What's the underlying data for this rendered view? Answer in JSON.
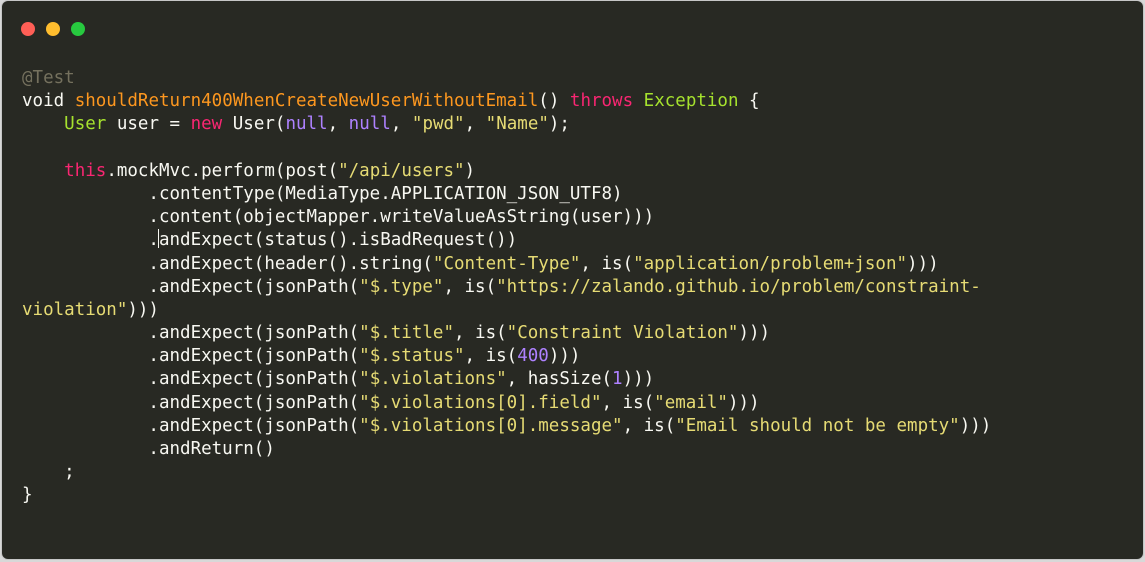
{
  "window": {
    "traffic_lights": [
      {
        "name": "close-button",
        "color": "#ff5f56"
      },
      {
        "name": "minimize-button",
        "color": "#ffbd2e"
      },
      {
        "name": "zoom-button",
        "color": "#27c93f"
      }
    ]
  },
  "colors": {
    "background": "#282923",
    "default": "#f8f8f2",
    "comment": "#75715e",
    "keyword": "#f92672",
    "function": "#fd971f",
    "type": "#a6e22e",
    "string": "#e6db74",
    "constant": "#ae81ff"
  },
  "editor": {
    "language": "java",
    "cursor": {
      "line": 7,
      "column": 13
    },
    "lines": [
      [
        {
          "t": "@Test",
          "c": "comment"
        }
      ],
      [
        {
          "t": "void",
          "c": "default"
        },
        {
          "t": " ",
          "c": "default"
        },
        {
          "t": "shouldReturn400WhenCreateNewUserWithoutEmail",
          "c": "function"
        },
        {
          "t": "() ",
          "c": "default"
        },
        {
          "t": "throws",
          "c": "keyword"
        },
        {
          "t": " ",
          "c": "default"
        },
        {
          "t": "Exception",
          "c": "type"
        },
        {
          "t": " {",
          "c": "default"
        }
      ],
      [
        {
          "t": "    ",
          "c": "default"
        },
        {
          "t": "User",
          "c": "type"
        },
        {
          "t": " user = ",
          "c": "default"
        },
        {
          "t": "new",
          "c": "keyword"
        },
        {
          "t": " User(",
          "c": "default"
        },
        {
          "t": "null",
          "c": "constant"
        },
        {
          "t": ", ",
          "c": "default"
        },
        {
          "t": "null",
          "c": "constant"
        },
        {
          "t": ", ",
          "c": "default"
        },
        {
          "t": "\"pwd\"",
          "c": "string"
        },
        {
          "t": ", ",
          "c": "default"
        },
        {
          "t": "\"Name\"",
          "c": "string"
        },
        {
          "t": ");",
          "c": "default"
        }
      ],
      [],
      [
        {
          "t": "    ",
          "c": "default"
        },
        {
          "t": "this",
          "c": "keyword"
        },
        {
          "t": ".mockMvc.perform(post(",
          "c": "default"
        },
        {
          "t": "\"/api/users\"",
          "c": "string"
        },
        {
          "t": ")",
          "c": "default"
        }
      ],
      [
        {
          "t": "            .contentType(MediaType.APPLICATION_JSON_UTF8)",
          "c": "default"
        }
      ],
      [
        {
          "t": "            .content(objectMapper.writeValueAsString(user)))",
          "c": "default"
        }
      ],
      [
        {
          "t": "            .andExpect(status().isBadRequest())",
          "c": "default"
        }
      ],
      [
        {
          "t": "            .andExpect(header().string(",
          "c": "default"
        },
        {
          "t": "\"Content-Type\"",
          "c": "string"
        },
        {
          "t": ", is(",
          "c": "default"
        },
        {
          "t": "\"application/problem+json\"",
          "c": "string"
        },
        {
          "t": ")))",
          "c": "default"
        }
      ],
      [
        {
          "t": "            .andExpect(jsonPath(",
          "c": "default"
        },
        {
          "t": "\"$.type\"",
          "c": "string"
        },
        {
          "t": ", is(",
          "c": "default"
        },
        {
          "t": "\"https://zalando.github.io/problem/constraint-",
          "c": "string"
        }
      ],
      [
        {
          "t": "violation\"",
          "c": "string"
        },
        {
          "t": ")))",
          "c": "default"
        }
      ],
      [
        {
          "t": "            .andExpect(jsonPath(",
          "c": "default"
        },
        {
          "t": "\"$.title\"",
          "c": "string"
        },
        {
          "t": ", is(",
          "c": "default"
        },
        {
          "t": "\"Constraint Violation\"",
          "c": "string"
        },
        {
          "t": ")))",
          "c": "default"
        }
      ],
      [
        {
          "t": "            .andExpect(jsonPath(",
          "c": "default"
        },
        {
          "t": "\"$.status\"",
          "c": "string"
        },
        {
          "t": ", is(",
          "c": "default"
        },
        {
          "t": "400",
          "c": "constant"
        },
        {
          "t": ")))",
          "c": "default"
        }
      ],
      [
        {
          "t": "            .andExpect(jsonPath(",
          "c": "default"
        },
        {
          "t": "\"$.violations\"",
          "c": "string"
        },
        {
          "t": ", hasSize(",
          "c": "default"
        },
        {
          "t": "1",
          "c": "constant"
        },
        {
          "t": ")))",
          "c": "default"
        }
      ],
      [
        {
          "t": "            .andExpect(jsonPath(",
          "c": "default"
        },
        {
          "t": "\"$.violations[0].field\"",
          "c": "string"
        },
        {
          "t": ", is(",
          "c": "default"
        },
        {
          "t": "\"email\"",
          "c": "string"
        },
        {
          "t": ")))",
          "c": "default"
        }
      ],
      [
        {
          "t": "            .andExpect(jsonPath(",
          "c": "default"
        },
        {
          "t": "\"$.violations[0].message\"",
          "c": "string"
        },
        {
          "t": ", is(",
          "c": "default"
        },
        {
          "t": "\"Email should not be empty\"",
          "c": "string"
        },
        {
          "t": ")))",
          "c": "default"
        }
      ],
      [
        {
          "t": "            .andReturn()",
          "c": "default"
        }
      ],
      [
        {
          "t": "    ;",
          "c": "default"
        }
      ],
      [
        {
          "t": "}",
          "c": "default"
        }
      ]
    ]
  }
}
